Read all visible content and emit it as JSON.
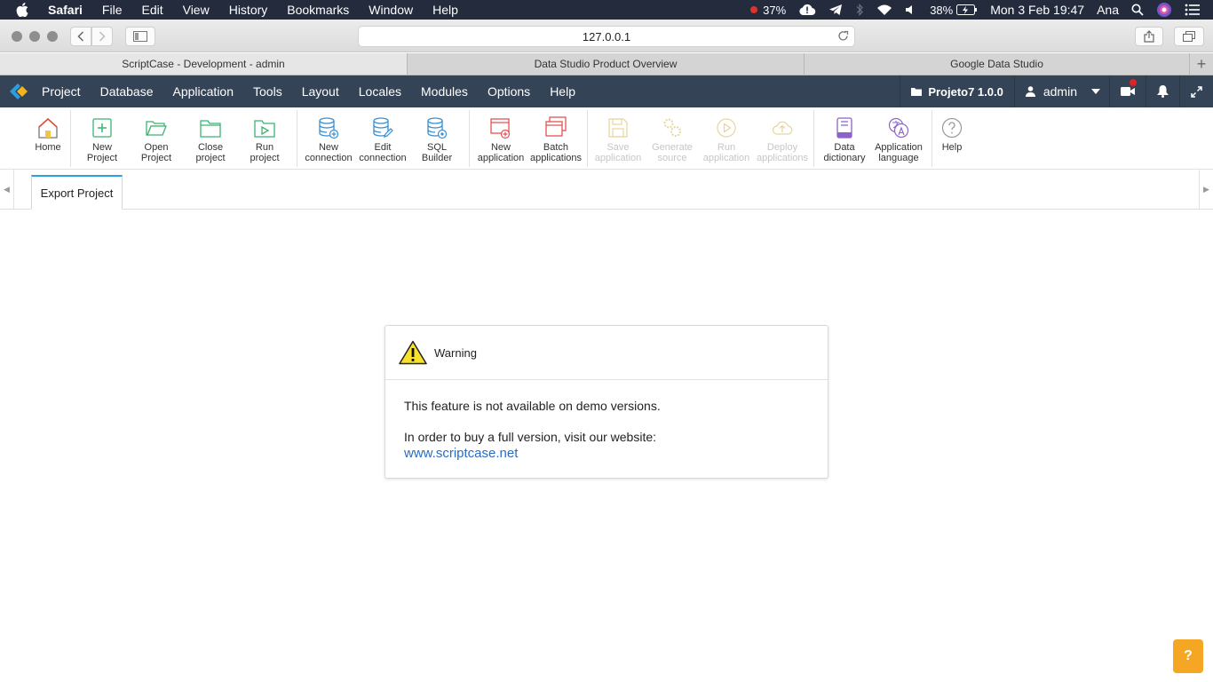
{
  "mac": {
    "app": "Safari",
    "menu": [
      "File",
      "Edit",
      "View",
      "History",
      "Bookmarks",
      "Window",
      "Help"
    ],
    "cpu": "37%",
    "battery": "38%",
    "clock": "Mon 3 Feb  19:47",
    "user": "Ana"
  },
  "safari": {
    "url": "127.0.0.1",
    "tabs": [
      {
        "label": "ScriptCase - Development - admin"
      },
      {
        "label": "Data Studio Product Overview"
      },
      {
        "label": "Google Data Studio"
      }
    ]
  },
  "sc_nav": {
    "menu": [
      "Project",
      "Database",
      "Application",
      "Tools",
      "Layout",
      "Locales",
      "Modules",
      "Options",
      "Help"
    ],
    "project": "Projeto7 1.0.0",
    "user": "admin"
  },
  "toolbar": {
    "home": "Home",
    "new_project": [
      "New",
      "Project"
    ],
    "open_project": [
      "Open",
      "Project"
    ],
    "close_project": [
      "Close",
      "project"
    ],
    "run_project": [
      "Run",
      "project"
    ],
    "new_connection": [
      "New",
      "connection"
    ],
    "edit_connection": [
      "Edit",
      "connection"
    ],
    "sql_builder": [
      "SQL",
      "Builder"
    ],
    "new_application": [
      "New",
      "application"
    ],
    "batch_applications": [
      "Batch",
      "applications"
    ],
    "save_application": [
      "Save",
      "application"
    ],
    "generate_source": [
      "Generate",
      "source"
    ],
    "run_application": [
      "Run",
      "application"
    ],
    "deploy_applications": [
      "Deploy",
      "applications"
    ],
    "data_dictionary": [
      "Data",
      "dictionary"
    ],
    "application_language": [
      "Application",
      "language"
    ],
    "help": "Help"
  },
  "subtabs": {
    "active": "Export Project"
  },
  "dialog": {
    "title": "Warning",
    "message": "This feature is not available on demo versions.",
    "buy_text": "In order to buy a full version, visit our website:",
    "link": "www.scriptcase.net"
  },
  "help_fab": "?"
}
